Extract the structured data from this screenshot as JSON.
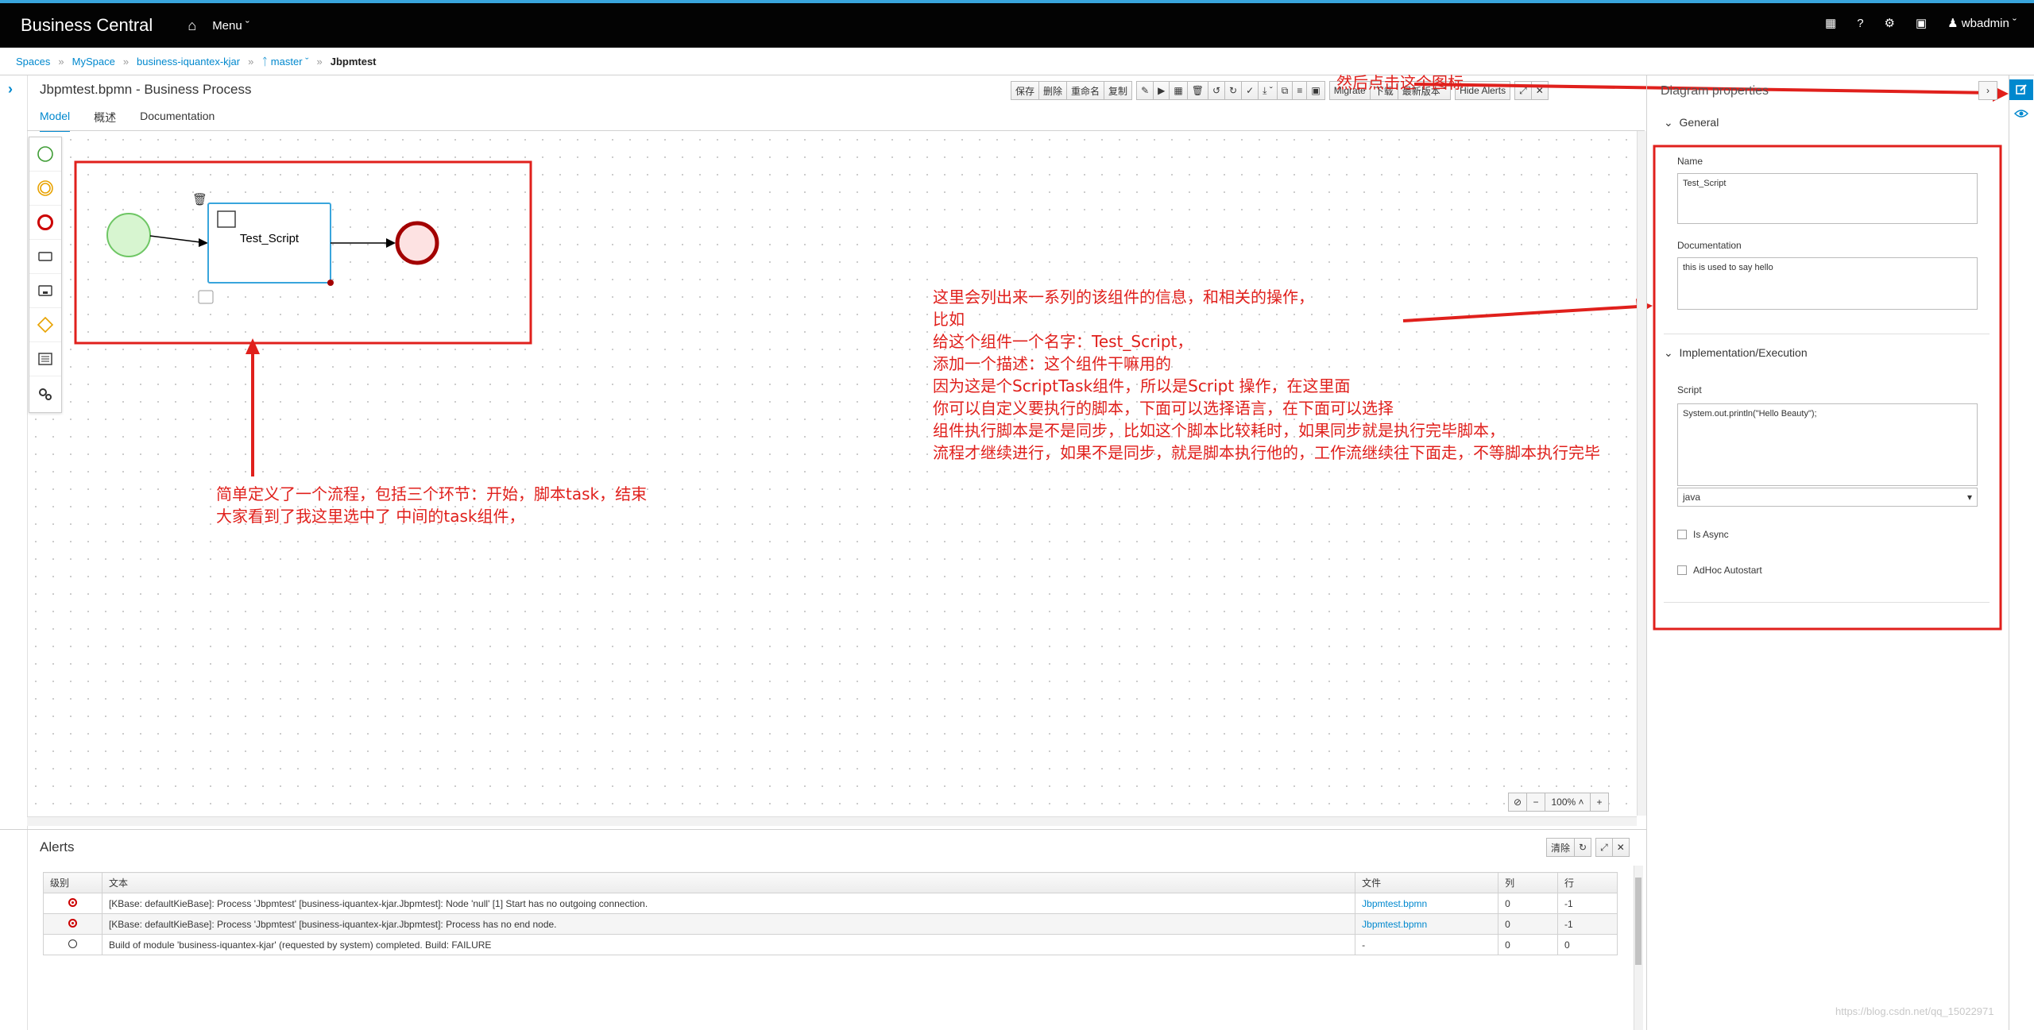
{
  "app": {
    "brand": "Business Central",
    "menu_label": "Menu",
    "user": "wbadmin"
  },
  "breadcrumb": {
    "items": [
      "Spaces",
      "MySpace",
      "business-iquantex-kjar",
      "master"
    ],
    "current": "Jbpmtest"
  },
  "editor": {
    "title": "Jbpmtest.bpmn - Business Process",
    "toolbar": {
      "save": "保存",
      "delete": "删除",
      "rename": "重命名",
      "copy": "复制",
      "migrate": "Migrate",
      "download": "下载",
      "latest_version": "最新版本",
      "hide_alerts": "Hide Alerts"
    },
    "tabs": [
      "Model",
      "概述",
      "Documentation"
    ],
    "active_tab": "Model",
    "zoom": "100%"
  },
  "diagram": {
    "task_label": "Test_Script"
  },
  "annotations": {
    "top_hint": "然后点击这个图标",
    "left_note": [
      "简单定义了一个流程，包括三个环节：开始，脚本task，结束",
      "大家看到了我这里选中了 中间的task组件，"
    ],
    "right_note": [
      "这里会列出来一系列的该组件的信息，和相关的操作，",
      "比如",
      "给这个组件一个名字：Test_Script，",
      "添加一个描述：这个组件干嘛用的",
      "因为这是个ScriptTask组件，所以是Script 操作，在这里面",
      "你可以自定义要执行的脚本，下面可以选择语言，在下面可以选择",
      "组件执行脚本是不是同步，比如这个脚本比较耗时，如果同步就是执行完毕脚本，",
      "流程才继续进行，如果不是同步，就是脚本执行他的，工作流继续往下面走，不等脚本执行完毕"
    ]
  },
  "alerts": {
    "title": "Alerts",
    "clear_label": "清除",
    "columns": [
      "级别",
      "文本",
      "文件",
      "列",
      "行"
    ],
    "rows": [
      {
        "level": "error",
        "text": "[KBase: defaultKieBase]: Process 'Jbpmtest' [business-iquantex-kjar.Jbpmtest]: Node 'null' [1] Start has no outgoing connection.",
        "file": "Jbpmtest.bpmn",
        "col": "0",
        "row": "-1"
      },
      {
        "level": "error",
        "text": "[KBase: defaultKieBase]: Process 'Jbpmtest' [business-iquantex-kjar.Jbpmtest]: Process has no end node.",
        "file": "Jbpmtest.bpmn",
        "col": "0",
        "row": "-1"
      },
      {
        "level": "info",
        "text": "Build of module 'business-iquantex-kjar' (requested by system) completed. Build: FAILURE",
        "file": "-",
        "col": "0",
        "row": "0"
      }
    ]
  },
  "properties": {
    "title": "Diagram properties",
    "general_section": "General",
    "name_label": "Name",
    "name_value": "Test_Script",
    "documentation_label": "Documentation",
    "documentation_value": "this is used to say hello",
    "impl_section": "Implementation/Execution",
    "script_label": "Script",
    "script_value": "System.out.println(\"Hello Beauty\");",
    "language_value": "java",
    "is_async_label": "Is Async",
    "adhoc_label": "AdHoc Autostart"
  },
  "watermark": "https://blog.csdn.net/qq_15022971",
  "colors": {
    "accent": "#0088ce",
    "annotation_red": "#e0201c",
    "start_event": "#6ec664",
    "end_event": "#a30000",
    "navbar": "#030303"
  }
}
